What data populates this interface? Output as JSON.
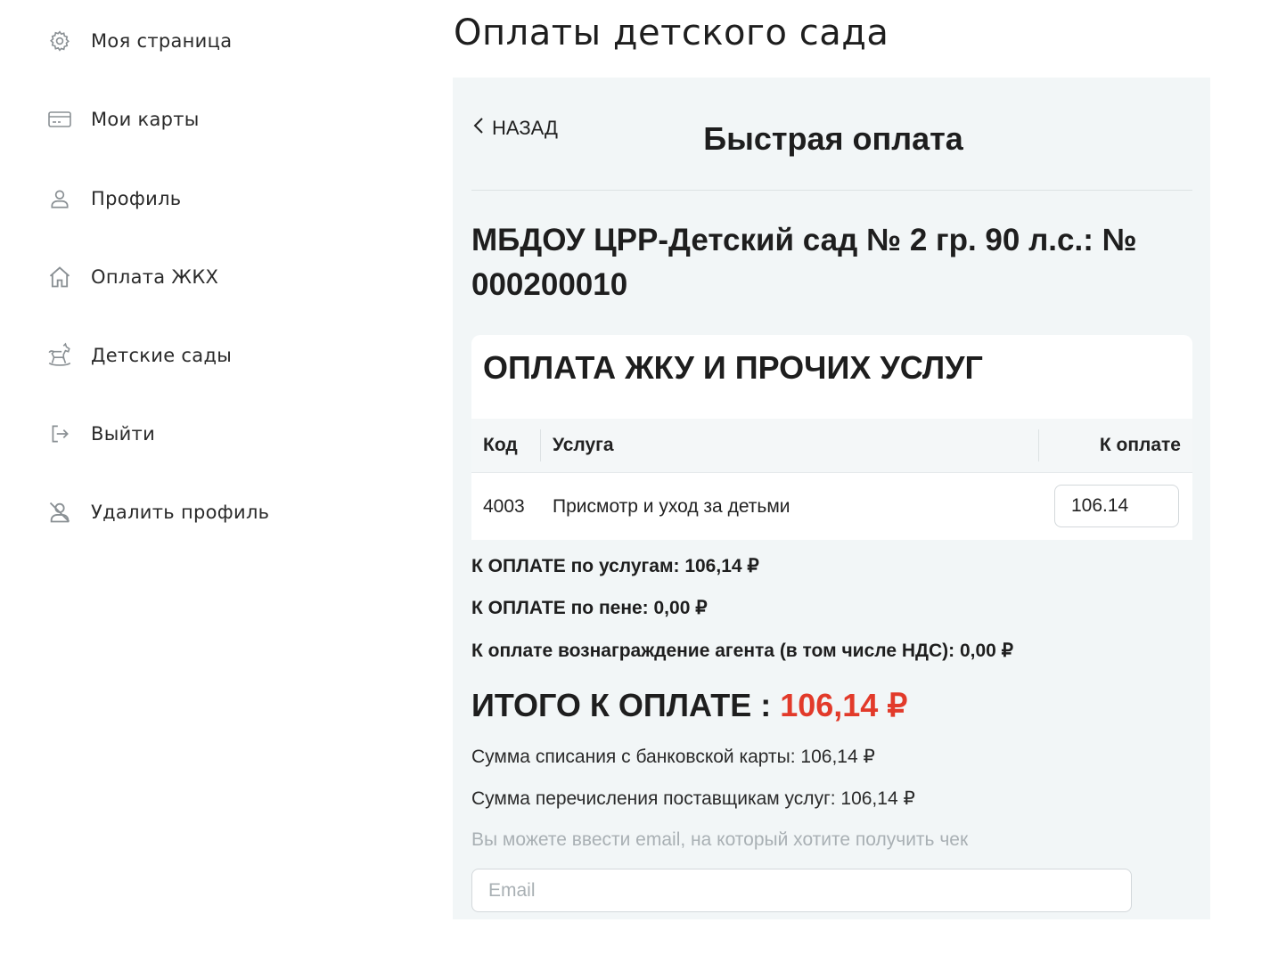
{
  "page": {
    "title": "Оплаты детского сада"
  },
  "sidebar": {
    "items": [
      {
        "label": "Моя страница",
        "icon": "gear-icon"
      },
      {
        "label": "Мои карты",
        "icon": "card-icon"
      },
      {
        "label": "Профиль",
        "icon": "user-icon"
      },
      {
        "label": "Оплата ЖКХ",
        "icon": "house-icon"
      },
      {
        "label": "Детские сады",
        "icon": "rocking-horse-icon"
      },
      {
        "label": "Выйти",
        "icon": "logout-icon"
      },
      {
        "label": "Удалить профиль",
        "icon": "delete-user-icon"
      }
    ]
  },
  "panel": {
    "back_label": "НАЗАД",
    "title": "Быстрая оплата",
    "org_title": "МБДОУ ЦРР-Детский сад № 2 гр. 90 л.с.: № 000200010",
    "card": {
      "title": "ОПЛАТА ЖКУ И ПРОЧИХ УСЛУГ",
      "columns": {
        "code": "Код",
        "service": "Услуга",
        "amount": "К оплате"
      },
      "rows": [
        {
          "code": "4003",
          "service": "Присмотр и уход за детьми",
          "amount": "106.14"
        }
      ]
    },
    "summary": {
      "services": "К ОПЛАТЕ по услугам: 106,14 ₽",
      "penalty": "К ОПЛАТЕ по пене: 0,00 ₽",
      "agent_fee": "К оплате вознаграждение агента (в том числе НДС): 0,00 ₽",
      "total_label": "ИТОГО К ОПЛАТЕ : ",
      "total_amount": "106,14 ₽",
      "card_debit": "Сумма списания с банковской карты: 106,14 ₽",
      "provider_transfer": "Сумма перечисления поставщикам услуг: 106,14 ₽"
    },
    "email": {
      "hint": "Вы можете ввести email, на который хотите получить чек",
      "placeholder": "Email",
      "value": ""
    }
  },
  "colors": {
    "panel_bg": "#f2f6f7",
    "total_accent": "#e23a2a",
    "hint": "#a9b0b4"
  }
}
